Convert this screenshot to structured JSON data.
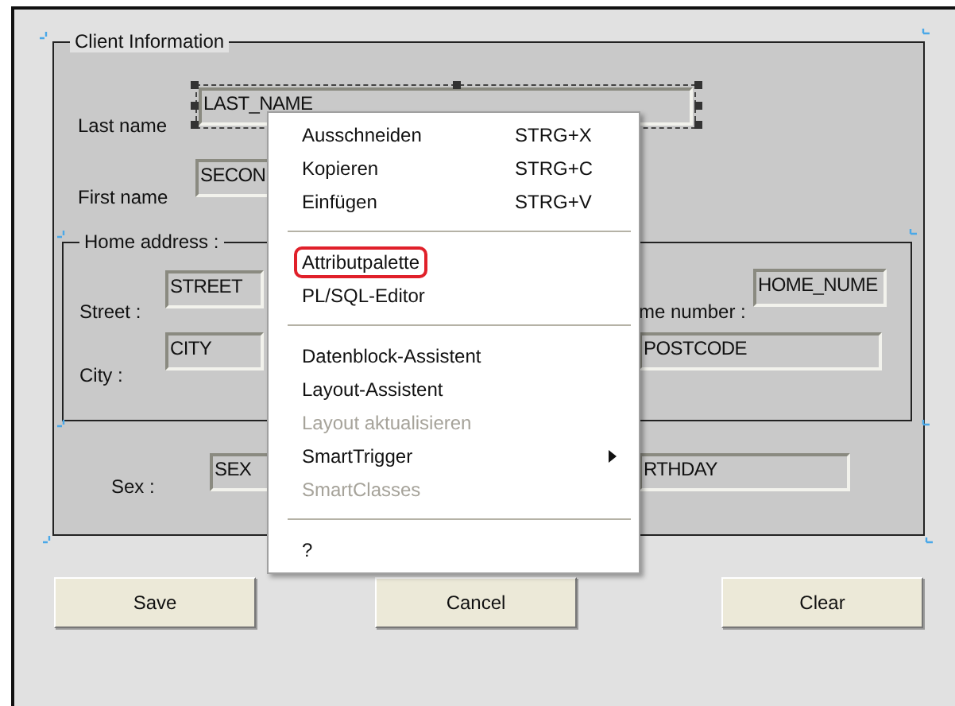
{
  "frame": {
    "title": "Client Information"
  },
  "fields": [
    {
      "label": "Last name",
      "value": "LAST_NAME",
      "selected": true
    },
    {
      "label": "First name",
      "value": "SECON",
      "selected": false
    }
  ],
  "home_address": {
    "title": "Home address :",
    "fields": [
      {
        "label": "Street :",
        "value": "STREET"
      },
      {
        "label": "me number :",
        "value": "HOME_NUME"
      },
      {
        "label": "City :",
        "value": "CITY"
      },
      {
        "value": "POSTCODE"
      }
    ]
  },
  "sex_field": {
    "label": "Sex :",
    "value": "SEX"
  },
  "birthday_field": {
    "value": "RTHDAY"
  },
  "context_menu": [
    {
      "kind": "item",
      "label": "Ausschneiden",
      "shortcut": "STRG+X",
      "disabled": false,
      "highlighted": false
    },
    {
      "kind": "item",
      "label": "Kopieren",
      "shortcut": "STRG+C",
      "disabled": false,
      "highlighted": false
    },
    {
      "kind": "item",
      "label": "Einfügen",
      "shortcut": "STRG+V",
      "disabled": false,
      "highlighted": false
    },
    {
      "kind": "separator"
    },
    {
      "kind": "item",
      "label": "Attributpalette",
      "disabled": false,
      "highlighted": true
    },
    {
      "kind": "item",
      "label": "PL/SQL-Editor",
      "disabled": false,
      "highlighted": false
    },
    {
      "kind": "separator"
    },
    {
      "kind": "item",
      "label": "Datenblock-Assistent",
      "disabled": false,
      "highlighted": false
    },
    {
      "kind": "item",
      "label": "Layout-Assistent",
      "disabled": false,
      "highlighted": false
    },
    {
      "kind": "item",
      "label": "Layout aktualisieren",
      "disabled": true,
      "highlighted": false
    },
    {
      "kind": "item",
      "label": "SmartTrigger",
      "disabled": false,
      "highlighted": false,
      "submenu": true
    },
    {
      "kind": "item",
      "label": "SmartClasses",
      "disabled": true,
      "highlighted": false
    },
    {
      "kind": "separator"
    },
    {
      "kind": "item",
      "label": "?",
      "disabled": false,
      "highlighted": false
    }
  ],
  "buttons": [
    "Save",
    "Cancel",
    "Clear"
  ]
}
